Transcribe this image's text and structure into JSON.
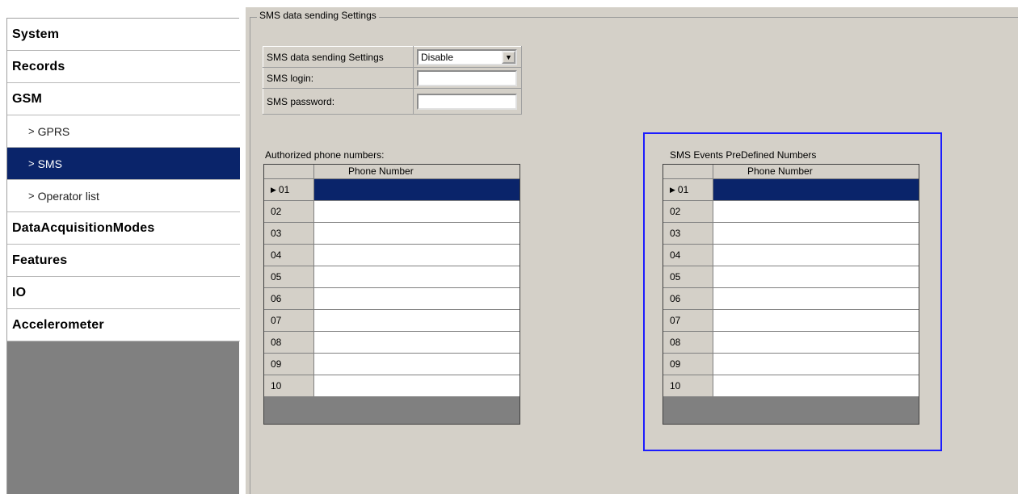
{
  "sidebar": {
    "items": [
      {
        "label": "System",
        "level": "top",
        "selected": false
      },
      {
        "label": "Records",
        "level": "top",
        "selected": false
      },
      {
        "label": "GSM",
        "level": "top",
        "selected": false
      },
      {
        "label": "GPRS",
        "level": "sub",
        "selected": false
      },
      {
        "label": "SMS",
        "level": "sub",
        "selected": true
      },
      {
        "label": "Operator list",
        "level": "sub",
        "selected": false
      },
      {
        "label": "DataAcquisitionModes",
        "level": "top",
        "selected": false
      },
      {
        "label": "Features",
        "level": "top",
        "selected": false
      },
      {
        "label": "IO",
        "level": "top",
        "selected": false
      },
      {
        "label": "Accelerometer",
        "level": "top",
        "selected": false
      }
    ],
    "sub_prefix": ">"
  },
  "group": {
    "title": "SMS data sending Settings"
  },
  "settings": {
    "sending_label": "SMS data sending Settings",
    "sending_value": "Disable",
    "login_label": "SMS login:",
    "login_value": "",
    "password_label": "SMS password:",
    "password_value": ""
  },
  "authorized": {
    "title": "Authorized phone numbers:",
    "column": "Phone Number",
    "rows": [
      "01",
      "02",
      "03",
      "04",
      "05",
      "06",
      "07",
      "08",
      "09",
      "10"
    ],
    "selected_row": "01"
  },
  "predefined": {
    "title": "SMS Events PreDefined Numbers",
    "column": "Phone Number",
    "rows": [
      "01",
      "02",
      "03",
      "04",
      "05",
      "06",
      "07",
      "08",
      "09",
      "10"
    ],
    "selected_row": "01"
  },
  "icons": {
    "row_marker": "▶",
    "dropdown": "▼"
  },
  "colors": {
    "selection": "#0a246a",
    "highlight_border": "#1c1cff",
    "panel": "#d4d0c8"
  }
}
